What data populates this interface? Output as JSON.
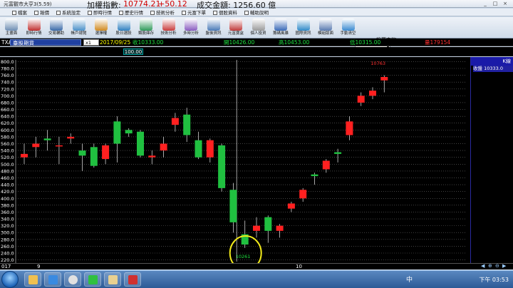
{
  "titlebar": {
    "app_title": "元富觀市大亨3(5.59)",
    "index_label": "加權指數:",
    "index_value": "10774.21",
    "index_change": "+50.12",
    "volume_label": "成交金額: 1256.60 億",
    "window_buttons": [
      "_",
      "□",
      "×"
    ]
  },
  "menu": [
    "檔案",
    "報價",
    "系統設定",
    "即時行情",
    "歷史行情",
    "技術分析",
    "元富下單",
    "個股資料",
    "輔助說明"
  ],
  "toolbar": {
    "buttons": [
      {
        "label": "主畫面",
        "icon": "home-icon",
        "color": "#6d8db3"
      },
      {
        "label": "即時行情",
        "icon": "realtime-icon",
        "color": "#c03030"
      },
      {
        "label": "交易輔助",
        "icon": "trade-icon",
        "color": "#3a6aa8"
      },
      {
        "label": "帳戶總覽",
        "icon": "account-icon",
        "color": "#4a90c8"
      },
      {
        "label": "選擇權",
        "icon": "options-icon",
        "color": "#d08a20"
      },
      {
        "label": "股日選股",
        "icon": "stock-pick-icon",
        "color": "#3080c0"
      },
      {
        "label": "類股庫存",
        "icon": "sector-icon",
        "color": "#2f9a5a"
      },
      {
        "label": "技術分析",
        "icon": "technical-icon",
        "color": "#c83c3c"
      },
      {
        "label": "多時分析",
        "icon": "multi-time-icon",
        "color": "#8a5cc0"
      },
      {
        "label": "盤後資訊",
        "icon": "news-icon",
        "color": "#4a7ab8"
      },
      {
        "label": "元富寶盒",
        "icon": "box-icon",
        "color": "#c03a3a"
      },
      {
        "label": "個人投資",
        "icon": "personal-icon",
        "color": "#9a9a9a"
      },
      {
        "label": "籌碼風暴",
        "icon": "chip-icon",
        "color": "#3a6ab8"
      },
      {
        "label": "國際資訊",
        "icon": "globe-icon",
        "color": "#2f8ac8"
      },
      {
        "label": "模組版面",
        "icon": "layout-icon",
        "color": "#5a7ab0"
      },
      {
        "label": "手動清空",
        "icon": "refresh-icon",
        "color": "#3a8ad0"
      }
    ],
    "query_label": "投票查詢",
    "query_value": ""
  },
  "quotebar": {
    "code": "TXA",
    "name": "臺股期貨",
    "interval": "x1",
    "date": "2017/09/25",
    "close": "收10333.00",
    "open": "開10426.00",
    "high": "高10453.00",
    "low": "低10315.00",
    "volume": "量179154",
    "price_box": "100.00"
  },
  "sidepanel": {
    "type": "K線",
    "close_label": "收盤",
    "close_value": "10333.0"
  },
  "chart_data": {
    "type": "candlestick",
    "y_ticks": [
      220,
      240,
      260,
      280,
      300,
      320,
      340,
      360,
      380,
      400,
      420,
      440,
      460,
      480,
      500,
      520,
      540,
      560,
      580,
      600,
      620,
      640,
      660,
      680,
      700,
      720,
      740,
      760,
      780,
      800
    ],
    "y_tick_labels": [
      "220.0",
      "240.0",
      "260.0",
      "280.0",
      "300.0",
      "320.0",
      "340.0",
      "360.0",
      "380.0",
      "400.0",
      "420.0",
      "440.0",
      "460.0",
      "480.0",
      "500.0",
      "520.0",
      "540.0",
      "560.0",
      "580.0",
      "600.0",
      "620.0",
      "640.0",
      "660.0",
      "680.0",
      "700.0",
      "720.0",
      "740.0",
      "760.0",
      "780.0",
      "800.0"
    ],
    "ylim": [
      215,
      805
    ],
    "x_labels": [
      "017",
      "9",
      "10"
    ],
    "high_annotation": "10763",
    "low_annotation": "10261",
    "bull_color": "#ff2020",
    "bear_color": "#20c040",
    "candles": [
      {
        "o": 520,
        "c": 530,
        "h": 560,
        "l": 500
      },
      {
        "o": 550,
        "c": 560,
        "h": 580,
        "l": 520
      },
      {
        "o": 575,
        "c": 570,
        "h": 600,
        "l": 540
      },
      {
        "o": 555,
        "c": 555,
        "h": 580,
        "l": 500
      },
      {
        "o": 575,
        "c": 580,
        "h": 590,
        "l": 560
      },
      {
        "o": 540,
        "c": 525,
        "h": 560,
        "l": 480
      },
      {
        "o": 550,
        "c": 495,
        "h": 560,
        "l": 490
      },
      {
        "o": 515,
        "c": 555,
        "h": 560,
        "l": 500
      },
      {
        "o": 625,
        "c": 560,
        "h": 640,
        "l": 505
      },
      {
        "o": 600,
        "c": 590,
        "h": 605,
        "l": 580
      },
      {
        "o": 595,
        "c": 525,
        "h": 600,
        "l": 520
      },
      {
        "o": 520,
        "c": 525,
        "h": 540,
        "l": 500
      },
      {
        "o": 540,
        "c": 560,
        "h": 580,
        "l": 520
      },
      {
        "o": 615,
        "c": 635,
        "h": 650,
        "l": 595
      },
      {
        "o": 645,
        "c": 585,
        "h": 665,
        "l": 565
      },
      {
        "o": 570,
        "c": 520,
        "h": 595,
        "l": 515
      },
      {
        "o": 520,
        "c": 570,
        "h": 575,
        "l": 505
      },
      {
        "o": 555,
        "c": 430,
        "h": 560,
        "l": 420
      },
      {
        "o": 425,
        "c": 330,
        "h": 445,
        "l": 300
      },
      {
        "o": 295,
        "c": 265,
        "h": 335,
        "l": 255
      },
      {
        "o": 305,
        "c": 320,
        "h": 345,
        "l": 285
      },
      {
        "o": 345,
        "c": 305,
        "h": 350,
        "l": 270
      },
      {
        "o": 305,
        "c": 320,
        "h": 325,
        "l": 285
      },
      {
        "o": 370,
        "c": 385,
        "h": 390,
        "l": 360
      },
      {
        "o": 400,
        "c": 425,
        "h": 430,
        "l": 390
      },
      {
        "o": 470,
        "c": 465,
        "h": 475,
        "l": 440
      },
      {
        "o": 485,
        "c": 510,
        "h": 515,
        "l": 475
      },
      {
        "o": 535,
        "c": 530,
        "h": 545,
        "l": 505
      },
      {
        "o": 585,
        "c": 625,
        "h": 640,
        "l": 570
      },
      {
        "o": 680,
        "c": 700,
        "h": 710,
        "l": 670
      },
      {
        "o": 700,
        "c": 715,
        "h": 725,
        "l": 690
      },
      {
        "o": 745,
        "c": 755,
        "h": 760,
        "l": 710
      }
    ]
  },
  "taskbar": {
    "apps": [
      {
        "icon": "folder-icon",
        "color": "#f0c050"
      },
      {
        "icon": "ie-icon",
        "color": "#3a8ae0"
      },
      {
        "icon": "chrome-icon",
        "color": "#e0e0e0"
      },
      {
        "icon": "line-icon",
        "color": "#30c040"
      },
      {
        "icon": "explorer-icon",
        "color": "#e8d090"
      },
      {
        "icon": "app-red-icon",
        "color": "#d03030"
      }
    ],
    "lang": "中",
    "clock": "下午 03:53"
  }
}
